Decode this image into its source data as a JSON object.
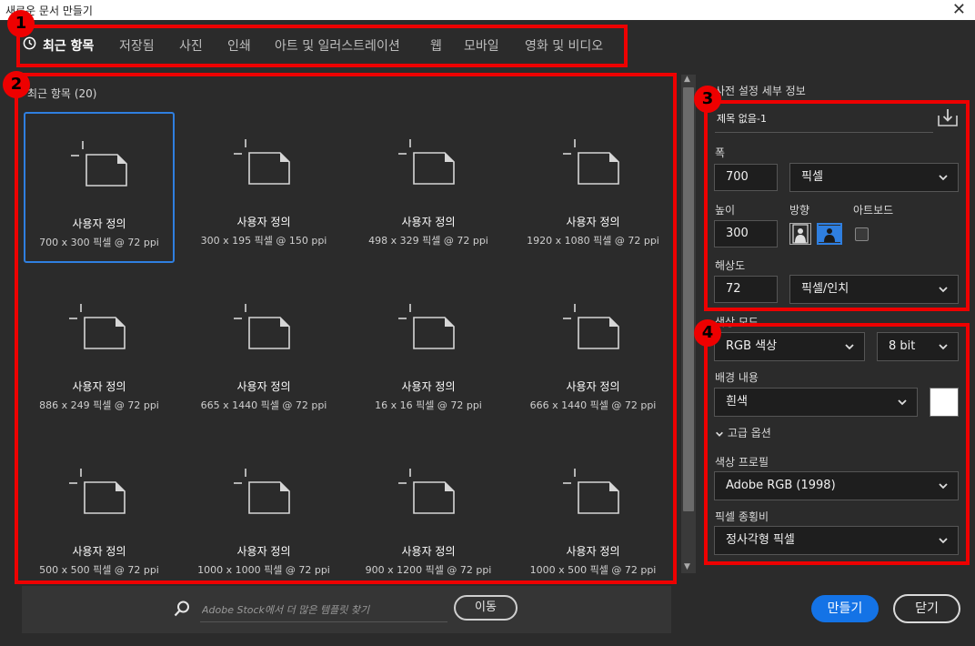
{
  "window": {
    "title": "새로운 문서 만들기",
    "close_symbol": "✕"
  },
  "tabs": [
    {
      "label": "최근 항목",
      "active": true
    },
    {
      "label": "저장됨"
    },
    {
      "label": "사진"
    },
    {
      "label": "인쇄"
    },
    {
      "label": "아트 및 일러스트레이션"
    },
    {
      "label": "웹"
    },
    {
      "label": "모바일"
    },
    {
      "label": "영화 및 비디오"
    }
  ],
  "annotations": {
    "badge1": "1",
    "badge2": "2",
    "badge3": "3",
    "badge4": "4",
    "color": "#e00000"
  },
  "recent": {
    "title": "최근 항목",
    "count": "(20)",
    "presets": [
      {
        "name": "사용자 정의",
        "dims": "700 x 300 픽셀 @ 72 ppi",
        "selected": true
      },
      {
        "name": "사용자 정의",
        "dims": "300 x 195 픽셀 @ 150 ppi"
      },
      {
        "name": "사용자 정의",
        "dims": "498 x 329 픽셀 @ 72 ppi"
      },
      {
        "name": "사용자 정의",
        "dims": "1920 x 1080 픽셀 @ 72 ppi"
      },
      {
        "name": "사용자 정의",
        "dims": "886 x 249 픽셀 @ 72 ppi"
      },
      {
        "name": "사용자 정의",
        "dims": "665 x 1440 픽셀 @ 72 ppi"
      },
      {
        "name": "사용자 정의",
        "dims": "16 x 16 픽셀 @ 72 ppi"
      },
      {
        "name": "사용자 정의",
        "dims": "666 x 1440 픽셀 @ 72 ppi"
      },
      {
        "name": "사용자 정의",
        "dims": "500 x 500 픽셀 @ 72 ppi"
      },
      {
        "name": "사용자 정의",
        "dims": "1000 x 1000 픽셀 @ 72 ppi"
      },
      {
        "name": "사용자 정의",
        "dims": "900 x 1200 픽셀 @ 72 ppi"
      },
      {
        "name": "사용자 정의",
        "dims": "1000 x 500 픽셀 @ 72 ppi"
      }
    ]
  },
  "search": {
    "placeholder": "Adobe Stock에서 더 많은 템플릿 찾기",
    "go_label": "이동"
  },
  "details": {
    "section_title": "사전 설정 세부 정보",
    "doc_name": "제목 없음-1",
    "width_label": "폭",
    "width_value": "700",
    "width_unit": "픽셀",
    "height_label": "높이",
    "height_value": "300",
    "orientation_label": "방향",
    "artboard_label": "아트보드",
    "resolution_label": "해상도",
    "resolution_value": "72",
    "resolution_unit": "픽셀/인치",
    "color_mode_label": "색상 모드",
    "color_mode": "RGB 색상",
    "bit_depth": "8 bit",
    "background_label": "배경 내용",
    "background_value": "흰색",
    "background_color": "#ffffff",
    "advanced_label": "고급 옵션",
    "color_profile_label": "색상 프로필",
    "color_profile": "Adobe RGB (1998)",
    "pixel_aspect_label": "픽셀 종횡비",
    "pixel_aspect": "정사각형 픽셀"
  },
  "buttons": {
    "create": "만들기",
    "close": "닫기"
  }
}
